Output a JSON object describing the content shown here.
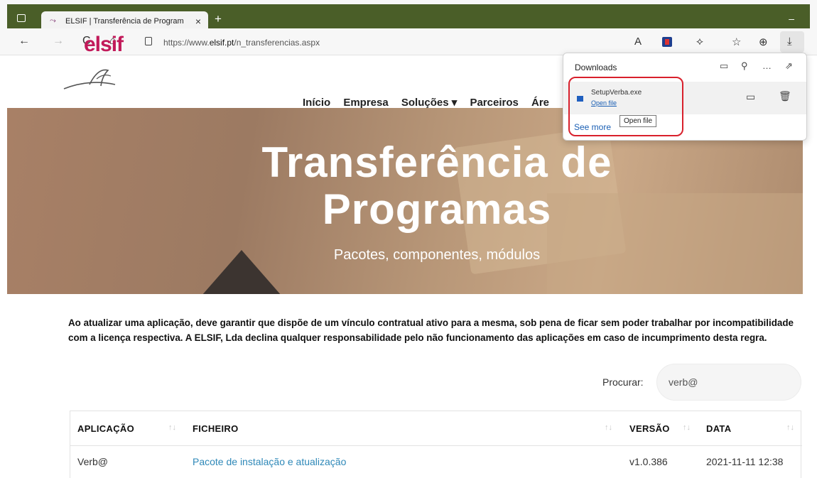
{
  "browser": {
    "tab_title": "ELSIF | Transferência de Program",
    "tab_close": "×",
    "new_tab": "+",
    "minimize": "–",
    "nav": {
      "back": "←",
      "forward": "→",
      "refresh": "C",
      "home": "⌂"
    },
    "url_prefix": "https://www.",
    "url_domain": "elsif.pt",
    "url_path": "/n_transferencias.aspx",
    "toolbar_icons": [
      "read-aloud-icon",
      "extension-icon",
      "puzzle-icon",
      "favorites-icon",
      "collections-icon",
      "downloads-icon"
    ]
  },
  "downloads": {
    "title": "Downloads",
    "file_name": "SetupVerba.exe",
    "open_file_link": "Open file",
    "see_more": "See more",
    "tooltip": "Open file"
  },
  "site": {
    "logo_text": "elsif",
    "nav": [
      "Início",
      "Empresa",
      "Soluções ▾",
      "Parceiros",
      "Áre"
    ],
    "hero_title_line1": "Transferência de",
    "hero_title_line2": "Programas",
    "hero_subtitle": "Pacotes, componentes, módulos",
    "notice": "Ao atualizar uma aplicação, deve garantir que dispõe de um vínculo contratual ativo para a mesma, sob pena de ficar sem poder trabalhar por incompatibilidade com a licença respectiva. A ELSIF, Lda declina qualquer responsabilidade pelo não funcionamento das aplicações em caso de incumprimento desta regra.",
    "search_label": "Procurar:",
    "search_value": "verb@"
  },
  "table": {
    "headers": [
      "APLICAÇÃO",
      "FICHEIRO",
      "VERSÃO",
      "DATA"
    ],
    "sort_glyph": "↑↓",
    "rows": [
      {
        "aplicacao": "Verb@",
        "ficheiro": "Pacote de instalação e atualização",
        "versao": "v1.0.386",
        "data": "2021-11-11 12:38"
      }
    ]
  }
}
